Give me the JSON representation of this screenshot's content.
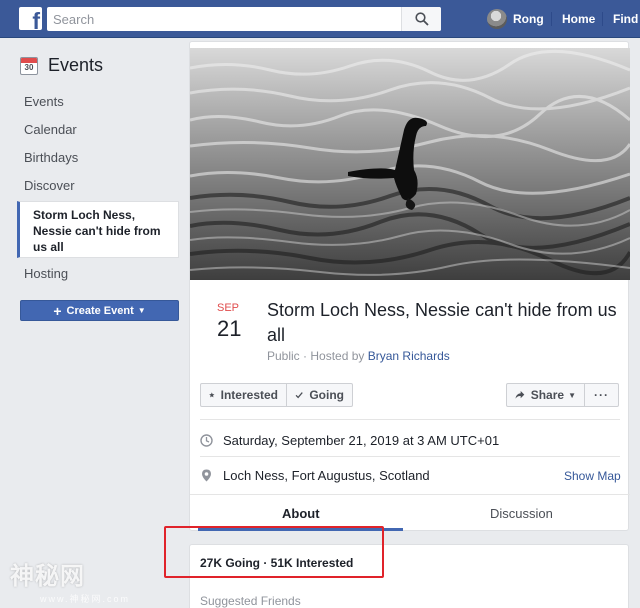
{
  "topbar": {
    "logo": "f",
    "search_placeholder": "Search",
    "user_name": "Rong",
    "home_label": "Home",
    "find_label": "Find F"
  },
  "sidebar": {
    "title": "Events",
    "calendar_icon_number": "30",
    "items": [
      {
        "label": "Events"
      },
      {
        "label": "Calendar"
      },
      {
        "label": "Birthdays"
      },
      {
        "label": "Discover"
      }
    ],
    "selected_item": "Storm Loch Ness, Nessie can't hide from us all",
    "hosting_label": "Hosting",
    "create_button": "Create Event"
  },
  "event": {
    "month": "SEP",
    "day": "21",
    "title": "Storm Loch Ness, Nessie can't hide from us all",
    "privacy": "Public",
    "hosted_by_prefix": " · Hosted by ",
    "host": "Bryan Richards",
    "buttons": {
      "interested": "Interested",
      "going": "Going",
      "share": "Share",
      "more": "···"
    },
    "datetime": "Saturday, September 21, 2019 at 3 AM UTC+01",
    "location": "Loch Ness, Fort Augustus, Scotland",
    "show_map": "Show Map",
    "tabs": {
      "about": "About",
      "discussion": "Discussion"
    }
  },
  "stats": {
    "going_interested": "27K Going · 51K Interested",
    "suggested_friends": "Suggested Friends"
  },
  "watermark": {
    "text": "神秘网",
    "sub": "www.神秘网.com"
  },
  "colors": {
    "brand": "#3b5998",
    "accent": "#4267b2",
    "highlight": "#e0232a",
    "date_red": "#e04c4c"
  }
}
